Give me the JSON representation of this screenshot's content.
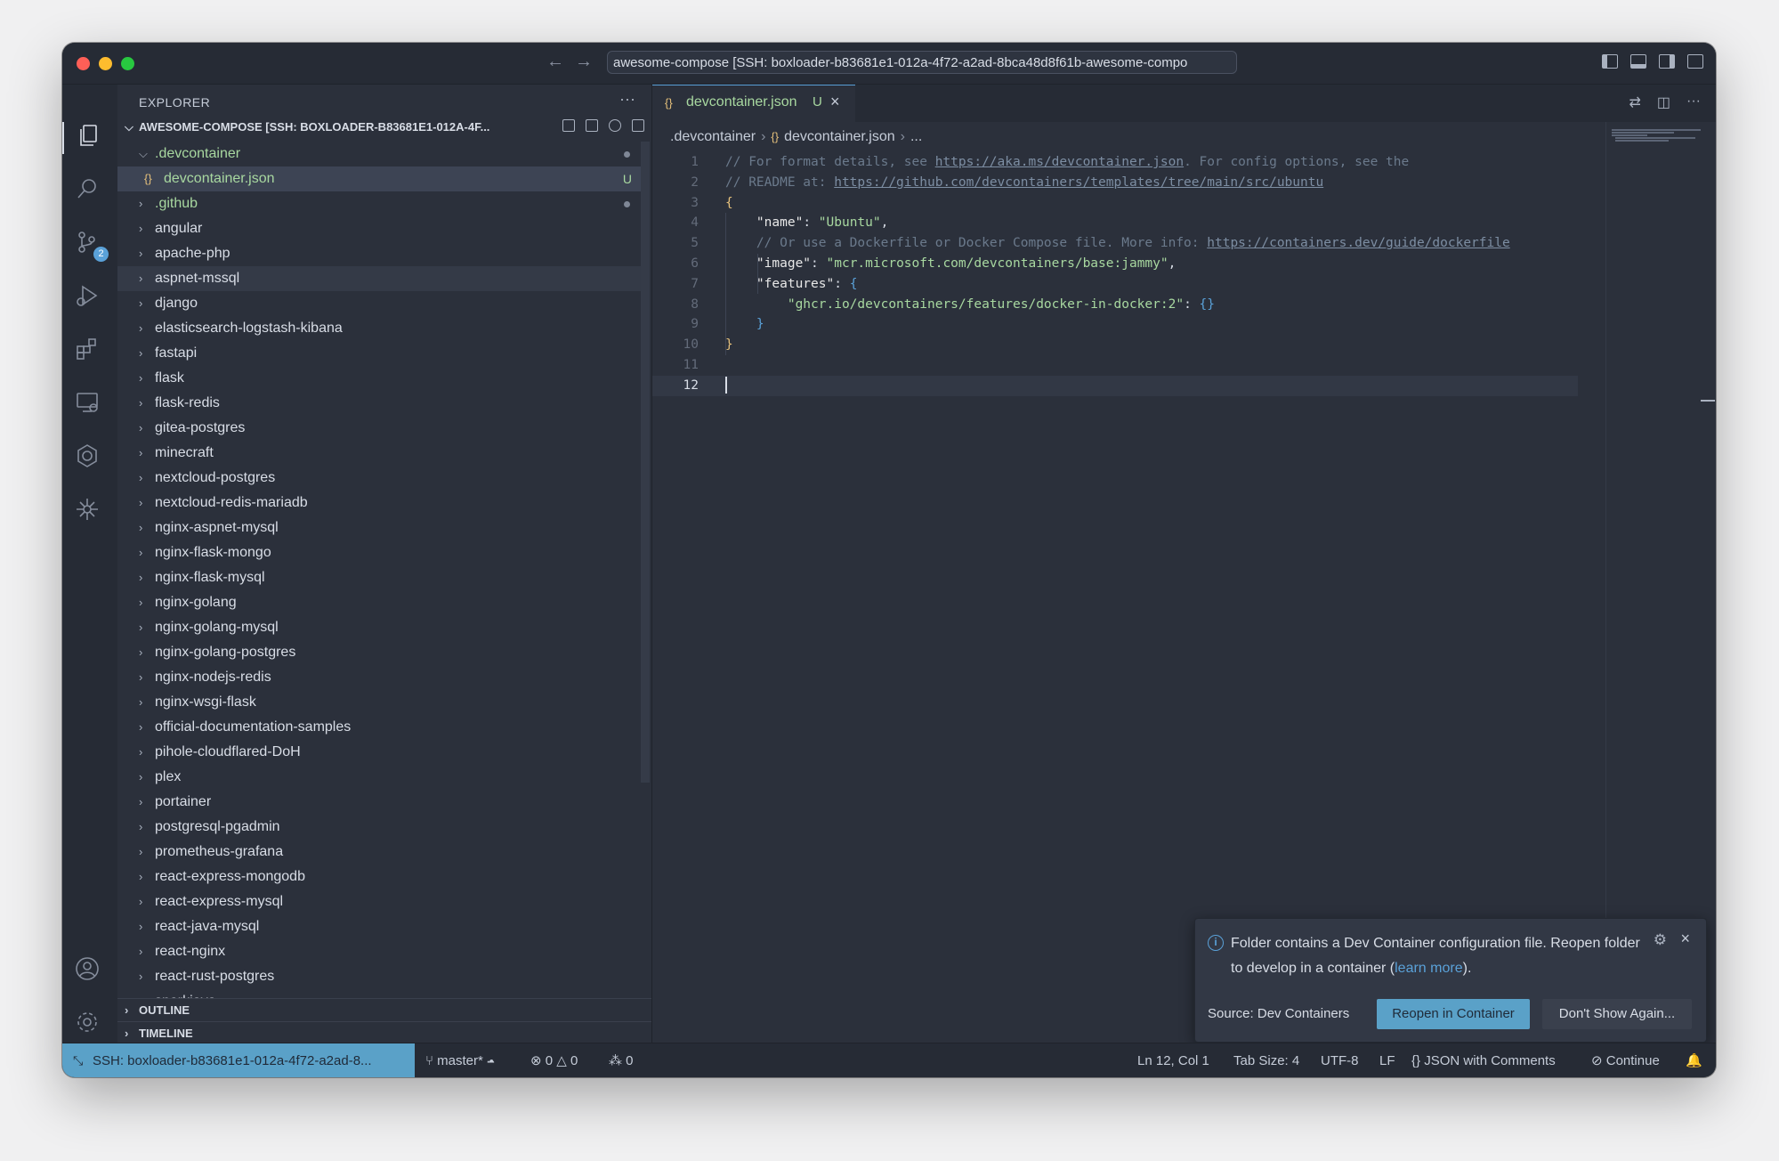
{
  "window": {
    "title": "awesome-compose [SSH: boxloader-b83681e1-012a-4f72-a2ad-8bca48d8f61b-awesome-compo"
  },
  "sidebar": {
    "title": "EXPLORER",
    "more": "···",
    "folder": "AWESOME-COMPOSE [SSH: BOXLOADER-B83681E1-012A-4F...",
    "open_subfolder": ".devcontainer",
    "open_file": "devcontainer.json",
    "open_file_status": "U",
    "items": [
      "angular",
      "apache-php",
      "aspnet-mssql",
      "django",
      "elasticsearch-logstash-kibana",
      "fastapi",
      "flask",
      "flask-redis",
      "gitea-postgres",
      "minecraft",
      "nextcloud-postgres",
      "nextcloud-redis-mariadb",
      "nginx-aspnet-mysql",
      "nginx-flask-mongo",
      "nginx-flask-mysql",
      "nginx-golang",
      "nginx-golang-mysql",
      "nginx-golang-postgres",
      "nginx-nodejs-redis",
      "nginx-wsgi-flask",
      "official-documentation-samples",
      "pihole-cloudflared-DoH",
      "plex",
      "portainer",
      "postgresql-pgadmin",
      "prometheus-grafana",
      "react-express-mongodb",
      "react-express-mysql",
      "react-java-mysql",
      "react-nginx",
      "react-rust-postgres",
      "sparkjava"
    ],
    "github_folder": ".github",
    "outline": "OUTLINE",
    "timeline": "TIMELINE"
  },
  "activity_bar": {
    "source_control_badge": "2"
  },
  "editor": {
    "tab": {
      "icon": "{}",
      "name": "devcontainer.json",
      "status": "U"
    },
    "breadcrumb": {
      "folder": ".devcontainer",
      "file_icon": "{}",
      "file": "devcontainer.json",
      "more": "..."
    },
    "lines": {
      "n1": "1",
      "n2": "2",
      "n3": "3",
      "n4": "4",
      "n5": "5",
      "n6": "6",
      "n7": "7",
      "n8": "8",
      "n9": "9",
      "n10": "10",
      "n11": "11",
      "n12": "12",
      "l1_comment": "// For format details, see ",
      "l1_url": "https://aka.ms/devcontainer.json",
      "l1_tail": ". For config options, see the",
      "l2_comment": "// README at: ",
      "l2_url": "https://github.com/devcontainers/templates/tree/main/src/ubuntu",
      "l3": "{",
      "l4_key": "\"name\"",
      "l4_val": "\"Ubuntu\"",
      "l5_comment": "// Or use a Dockerfile or Docker Compose file. More info: ",
      "l5_url": "https://containers.dev/guide/dockerfile",
      "l6_key": "\"image\"",
      "l6_val": "\"mcr.microsoft.com/devcontainers/base:jammy\"",
      "l7_key": "\"features\"",
      "l7_brace": "{",
      "l8_key": "\"ghcr.io/devcontainers/features/docker-in-docker:2\"",
      "l8_val": "{}",
      "l9": "}",
      "l10": "}"
    }
  },
  "notification": {
    "message": "Folder contains a Dev Container configuration file. Reopen folder to develop in a container (",
    "link": "learn more",
    "message_end": ").",
    "source": "Source: Dev Containers",
    "primary_button": "Reopen in Container",
    "secondary_button": "Don't Show Again..."
  },
  "statusbar": {
    "remote": "SSH: boxloader-b83681e1-012a-4f72-a2ad-8...",
    "branch": "master*",
    "errors": "0",
    "warnings": "0",
    "ports": "0",
    "position": "Ln 12, Col 1",
    "tab_size": "Tab Size: 4",
    "encoding": "UTF-8",
    "eol": "LF",
    "language": "JSON with Comments",
    "continue": "Continue"
  },
  "colors": {
    "accent": "#5aa1c8",
    "untracked": "#a8d8a0",
    "background": "#2b303b"
  }
}
